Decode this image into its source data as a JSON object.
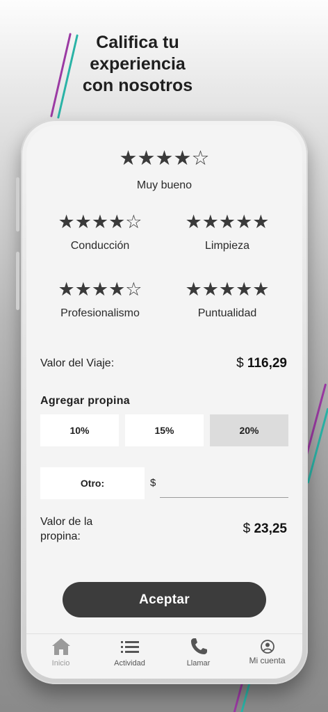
{
  "headline": {
    "line1": "Califica tu",
    "line2": "experiencia",
    "line3": "con nosotros"
  },
  "colors": {
    "accent_purple": "#9b3aa3",
    "accent_teal": "#2ab3a6",
    "button_dark": "#3c3c3c",
    "selected_tip": "#dcdcdc"
  },
  "rating": {
    "overall": {
      "stars": "★★★★☆",
      "value": 4,
      "label": "Muy bueno"
    },
    "categories": [
      {
        "stars": "★★★★☆",
        "value": 4,
        "label": "Conducción"
      },
      {
        "stars": "★★★★★",
        "value": 5,
        "label": "Limpieza"
      },
      {
        "stars": "★★★★☆",
        "value": 4,
        "label": "Profesionalismo"
      },
      {
        "stars": "★★★★★",
        "value": 5,
        "label": "Puntualidad"
      }
    ]
  },
  "trip": {
    "label": "Valor del Viaje:",
    "currency": "$",
    "amount": "116,29"
  },
  "tip": {
    "title": "Agregar propina",
    "options": [
      "10%",
      "15%",
      "20%"
    ],
    "selected": "20%",
    "other_label": "Otro:",
    "other_currency": "$",
    "other_value": "",
    "value_label_line1": "Valor de la",
    "value_label_line2": "propina:",
    "currency": "$",
    "amount": "23,25"
  },
  "accept_label": "Aceptar",
  "tabs": [
    {
      "label": "Inicio",
      "icon": "home-icon",
      "active": false
    },
    {
      "label": "Actividad",
      "icon": "list-icon",
      "active": false
    },
    {
      "label": "Llamar",
      "icon": "phone-icon",
      "active": false
    },
    {
      "label": "Mi cuenta",
      "icon": "account-icon",
      "active": true
    }
  ]
}
